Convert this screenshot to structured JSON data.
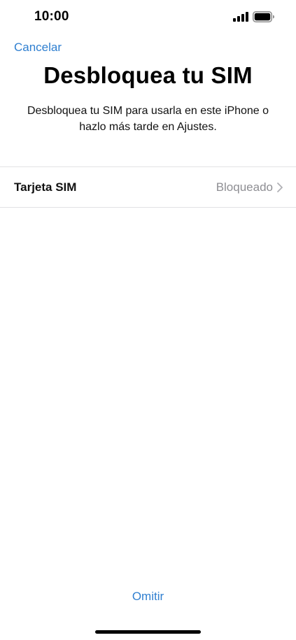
{
  "status_bar": {
    "time": "10:00",
    "icons": [
      "signal-icon",
      "battery-icon"
    ]
  },
  "nav": {
    "cancel_label": "Cancelar"
  },
  "header": {
    "title": "Desbloquea tu SIM",
    "subtitle": "Desbloquea tu SIM para usarla en este iPhone o hazlo más tarde en Ajustes."
  },
  "sim_row": {
    "label": "Tarjeta SIM",
    "value": "Bloqueado",
    "icon": "chevron-right-icon"
  },
  "footer": {
    "skip_label": "Omitir"
  },
  "colors": {
    "accent": "#2f7fd0",
    "secondary_text": "#8e8e93",
    "separator": "#e2e2e4",
    "background": "#ffffff"
  }
}
